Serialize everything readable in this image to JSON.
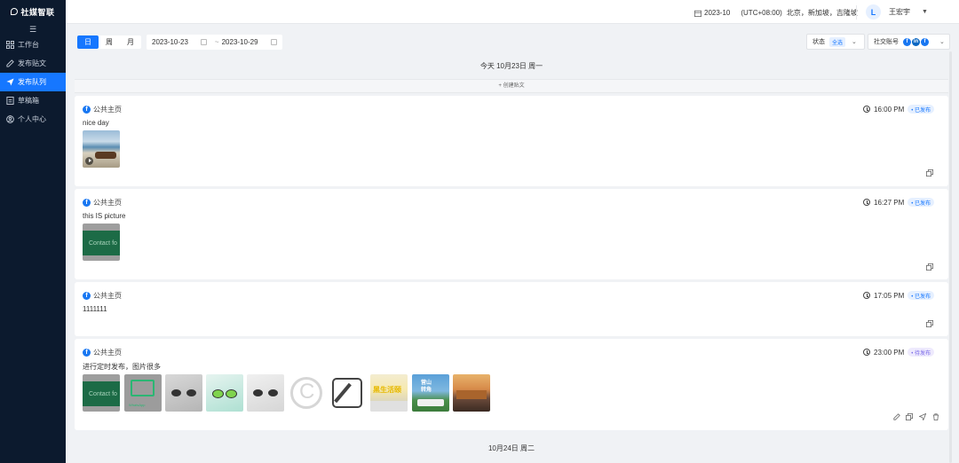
{
  "app": {
    "logo": "社媒智联"
  },
  "sidebar": {
    "collapse_icon": "menu-fold-icon",
    "items": [
      {
        "label": "工作台",
        "icon": "dashboard-icon",
        "active": false
      },
      {
        "label": "发布贴文",
        "icon": "edit-icon",
        "active": false
      },
      {
        "label": "发布队列",
        "icon": "send-icon",
        "active": true
      },
      {
        "label": "草稿箱",
        "icon": "draft-icon",
        "active": false
      },
      {
        "label": "个人中心",
        "icon": "user-icon",
        "active": false
      }
    ]
  },
  "topbar": {
    "month": "2023-10",
    "timezone": "(UTC+08:00)",
    "cities": "北京，新加坡，吉隆坡",
    "user_initial": "L",
    "user_name": "王宏宇"
  },
  "toolbar": {
    "view_tabs": [
      "日",
      "周",
      "月"
    ],
    "active_view": "日",
    "date_start": "2023-10-23",
    "date_sep": "~",
    "date_end": "2023-10-29",
    "status_label": "状态",
    "status_value": "全选",
    "social_label": "社交账号"
  },
  "timeline": {
    "today_header": "今天  10月23日  周一",
    "create_post": "+ 创建贴文",
    "next_day_header": "10月24日  周二"
  },
  "posts": [
    {
      "source": "公共主页",
      "text": "nice day",
      "time": "16:00 PM",
      "status": "• 已发布"
    },
    {
      "source": "公共主页",
      "text": "this IS picture",
      "time": "16:27 PM",
      "status": "• 已发布",
      "image_text": "Contact fo"
    },
    {
      "source": "公共主页",
      "text": "1111111",
      "time": "17:05 PM",
      "status": "• 已发布"
    },
    {
      "source": "公共主页",
      "text": "进行定时发布，图片很多",
      "time": "23:00 PM",
      "status": "• 待发布",
      "image_text": "Contact fo",
      "chat_caption": "WhatsApp",
      "yellow_text": "黑生活颐",
      "bus_text": "营山\n转角"
    }
  ],
  "colors": {
    "primary": "#1677ff",
    "sidebar_bg": "#0c1a2e",
    "facebook": "#1877f2"
  }
}
